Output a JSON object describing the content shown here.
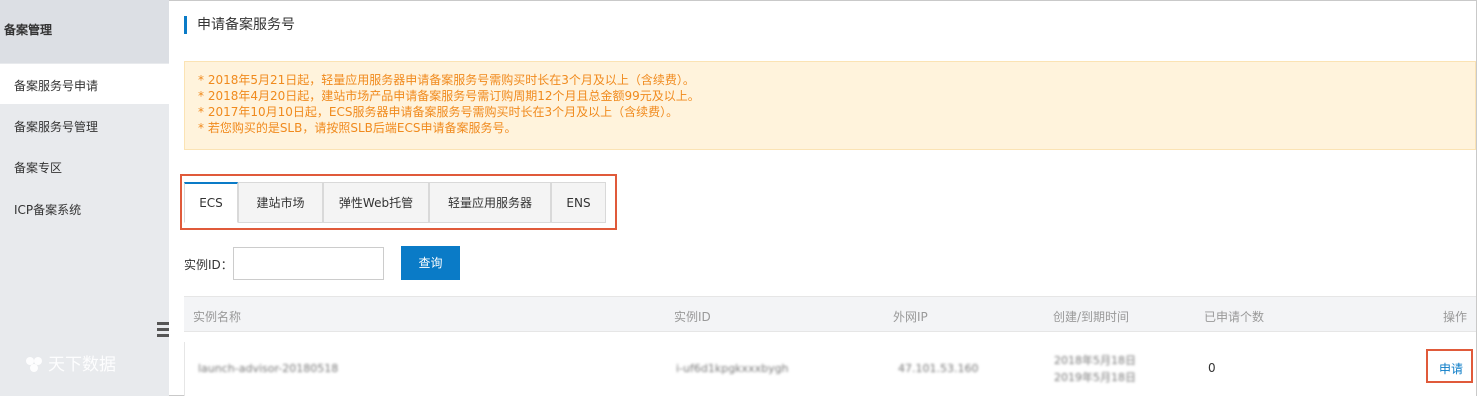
{
  "sidebar": {
    "header": "备案管理",
    "items": [
      {
        "label": "备案服务号申请"
      },
      {
        "label": "备案服务号管理"
      },
      {
        "label": "备案专区"
      },
      {
        "label": "ICP备案系统"
      }
    ],
    "watermark": "天下数据"
  },
  "page": {
    "title": "申请备案服务号"
  },
  "notice": {
    "lines": [
      "* 2018年5月21日起，轻量应用服务器申请备案服务号需购买时长在3个月及以上（含续费）。",
      "* 2018年4月20日起，建站市场产品申请备案服务号需订购周期12个月且总金额99元及以上。",
      "* 2017年10月10日起，ECS服务器申请备案服务号需购买时长在3个月及以上（含续费）。",
      "* 若您购买的是SLB，请按照SLB后端ECS申请备案服务号。"
    ]
  },
  "tabs": [
    {
      "label": "ECS",
      "active": true
    },
    {
      "label": "建站市场"
    },
    {
      "label": "弹性Web托管"
    },
    {
      "label": "轻量应用服务器"
    },
    {
      "label": "ENS"
    }
  ],
  "search": {
    "label": "实例ID：",
    "value": "",
    "button": "查询"
  },
  "table": {
    "headers": [
      "实例名称",
      "实例ID",
      "外网IP",
      "创建/到期时间",
      "已申请个数",
      "操作"
    ],
    "rows": [
      {
        "name": "launch-advisor-20180518",
        "id": "i-uf6d1kpgkxxxbygh",
        "ip": "47.101.53.160",
        "created": "2018年5月18日",
        "expires": "2019年5月18日",
        "count": "0",
        "action": "申请"
      }
    ]
  },
  "colors": {
    "accent": "#0a7bc7",
    "notice_text": "#f08a1d",
    "notice_bg": "#fff3dc",
    "highlight": "#e05a3a"
  }
}
